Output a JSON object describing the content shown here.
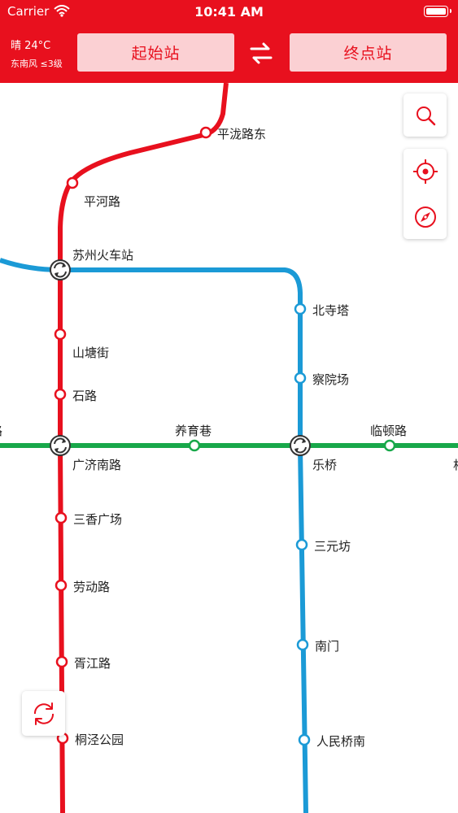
{
  "status_bar": {
    "carrier": "Carrier",
    "time": "10:41 AM"
  },
  "weather": {
    "temp": "晴 24°C",
    "wind": "东南风 ≤3级"
  },
  "route": {
    "start_label": "起始站",
    "end_label": "终点站"
  },
  "stations": {
    "pinglongludong": "平泷路东",
    "pinghelu": "平河路",
    "suzhouhuochezhan": "苏州火车站",
    "beisita": "北寺塔",
    "shantangjie": "山塘街",
    "chayuanchang": "察院场",
    "shilu": "石路",
    "yangyuxiang": "养育巷",
    "lindunlu": "临顿路",
    "guangjinanlu": "广济南路",
    "leqiao": "乐桥",
    "sanxiangguangchang": "三香广场",
    "sanyuanfang": "三元坊",
    "laodonglu": "劳动路",
    "nanmen": "南门",
    "xujianglu": "胥江路",
    "tongjinggongyuan": "桐泾公园",
    "renminqiaonan": "人民桥南"
  },
  "lines": {
    "line1_color": "#e8101e",
    "line2_color": "#1b9ad6",
    "line4_color": "#18a84a"
  },
  "icons": {
    "search": "search-icon",
    "locate": "locate-icon",
    "compass": "compass-icon",
    "refresh": "refresh-icon",
    "swap": "swap-icon"
  }
}
